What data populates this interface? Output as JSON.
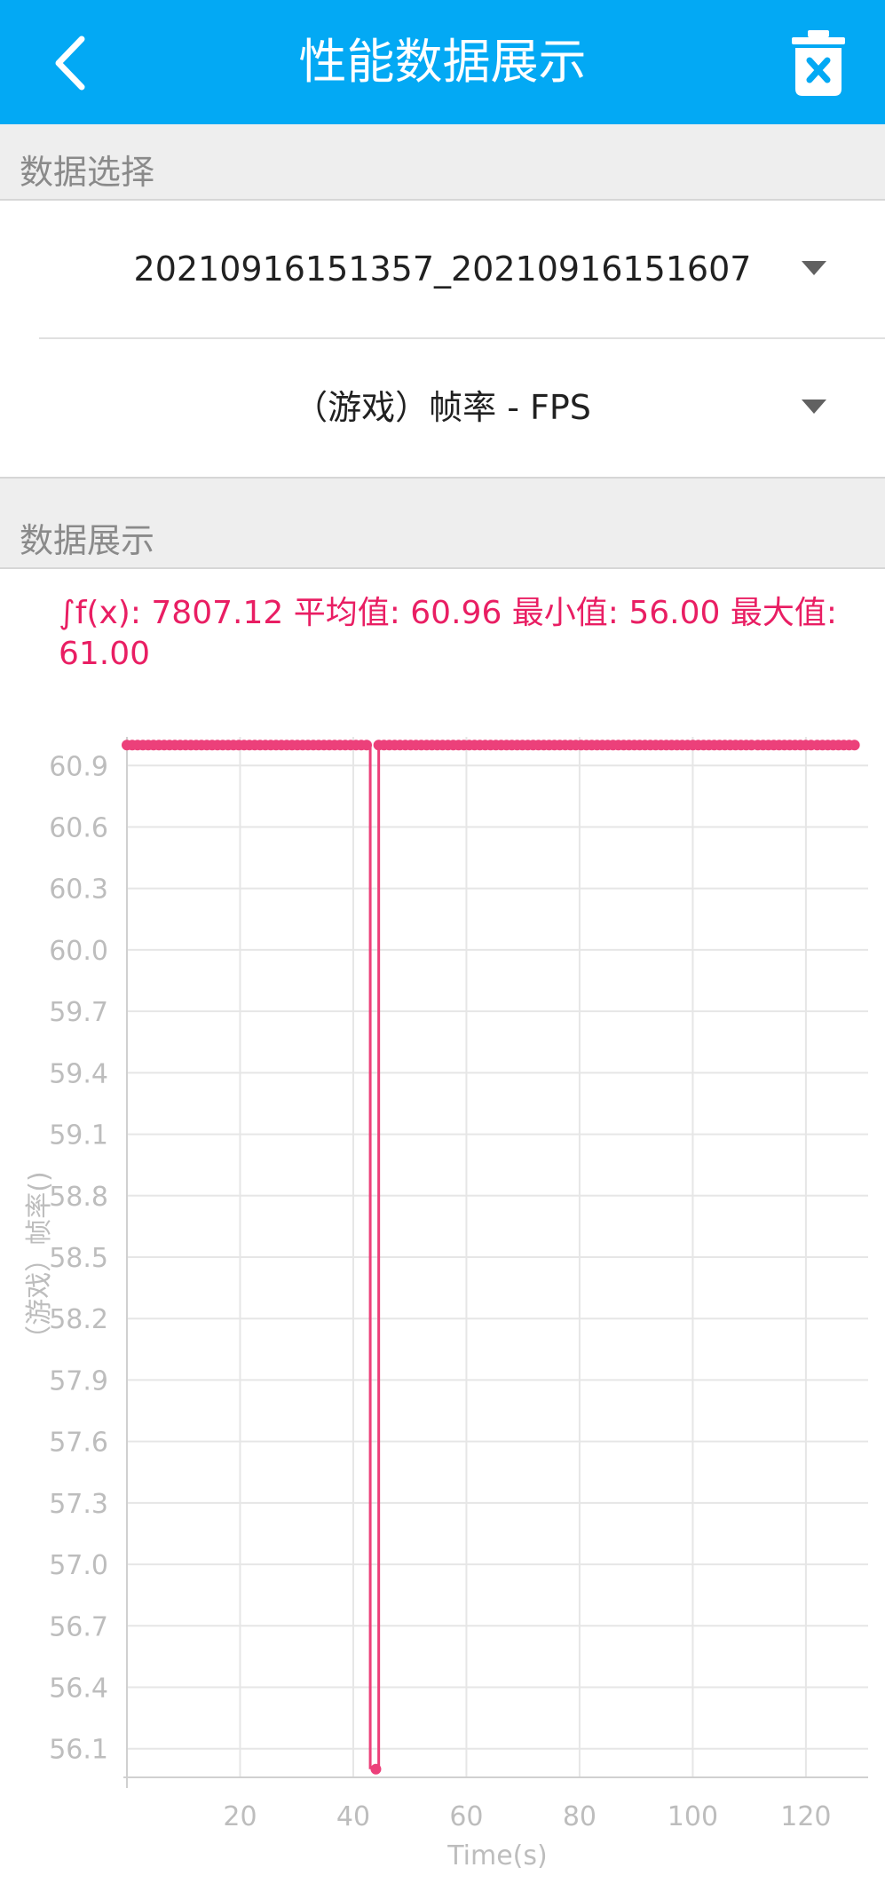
{
  "app_bar": {
    "title": "性能数据展示",
    "back_icon": "chevron-left-icon",
    "delete_icon": "trash-icon",
    "color": "#03A9F4"
  },
  "data_select": {
    "header": "数据选择",
    "session_value": "20210916151357_20210916151607",
    "metric_value": "（游戏）帧率 - FPS"
  },
  "data_display": {
    "header": "数据展示",
    "stats_text": "∫f(x): 7807.12 平均值: 60.96 最小值: 56.00 最大值: 61.00"
  },
  "chart_data": {
    "type": "line",
    "xlabel": "Time(s)",
    "ylabel": "（游戏）帧率()",
    "xlim": [
      0,
      131
    ],
    "ylim": [
      55.96,
      61.04
    ],
    "x_ticks": [
      "20",
      "40",
      "60",
      "80",
      "100",
      "120"
    ],
    "y_ticks": [
      "56.1",
      "56.4",
      "56.7",
      "57.0",
      "57.3",
      "57.6",
      "57.9",
      "58.2",
      "58.5",
      "58.8",
      "59.1",
      "59.4",
      "59.7",
      "60.0",
      "60.3",
      "60.6",
      "60.9"
    ],
    "grid": true,
    "line_color": "#EC407A",
    "series": [
      {
        "segments": [
          {
            "x_start": 0,
            "x_end": 43.0,
            "y": 61.0
          },
          {
            "x_start": 43.0,
            "x_end": 43.0,
            "y_from": 61.0,
            "y_to": 56.0
          },
          {
            "x_start": 44.5,
            "x_end": 44.5,
            "y_from": 56.0,
            "y_to": 61.0
          },
          {
            "x_start": 44.5,
            "x_end": 111.0,
            "y": 61.0
          },
          {
            "x_start": 111.5,
            "x_end": 121.0,
            "y": 61.0
          },
          {
            "x_start": 122.0,
            "x_end": 129.0,
            "y": 61.0
          }
        ],
        "min_point": {
          "x": 44.0,
          "y": 56.0
        }
      }
    ]
  }
}
